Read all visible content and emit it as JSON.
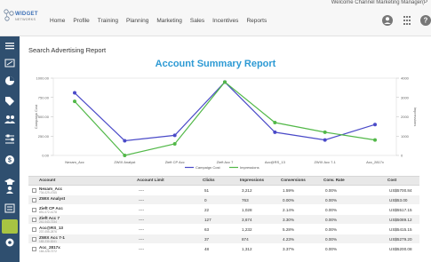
{
  "header": {
    "welcome": "Welcome Channel Marketing Manager(P",
    "logo_main": "WIDGET",
    "logo_sub": "NETWORKS",
    "nav": [
      "Home",
      "Profile",
      "Training",
      "Planning",
      "Marketing",
      "Sales",
      "Incentives",
      "Reports"
    ],
    "icons": [
      "user-icon",
      "apps-grid-icon",
      "help-icon"
    ]
  },
  "sidebar": {
    "icons": [
      "menu-icon",
      "dashboard-icon",
      "pie-chart-icon",
      "tag-icon",
      "people-icon",
      "sliders-icon",
      "dollar-icon",
      "cap-icon",
      "person-active-icon",
      "news-icon",
      "settings-icon"
    ],
    "active_color": "#a7c442",
    "bg_color": "#2f4f6f"
  },
  "page": {
    "title": "Search Advertising Report"
  },
  "chart_data": {
    "type": "line",
    "title": "Account Summary Report",
    "categories": [
      "Nexam_Acc",
      "ZWIX Analyst",
      "Zieft CP Acc",
      "Zieft Acc 7",
      "Acc@RS_13",
      "ZWIX Acc 7-1",
      "Acc_2817x"
    ],
    "ylabel_left": "Campaign Cost",
    "ylabel_right": "Impressions",
    "ylim_left": [
      0,
      1000
    ],
    "ylim_right": [
      0,
      4000
    ],
    "left_ticks": [
      "1000.00",
      "750.00",
      "500.00",
      "250.00",
      "0.00"
    ],
    "right_ticks": [
      "4000",
      "3000",
      "2000",
      "1000",
      "0"
    ],
    "series": [
      {
        "name": "Campaign Cost",
        "axis": "left",
        "color": "#4a4ac8",
        "values": [
          810,
          190,
          260,
          950,
          300,
          200,
          400
        ]
      },
      {
        "name": "Impressions",
        "axis": "right",
        "color": "#52b848",
        "values": [
          2800,
          0,
          600,
          3800,
          1700,
          1200,
          800
        ]
      }
    ],
    "legend": [
      "Campaign Cost",
      "Impressions"
    ]
  },
  "table": {
    "columns": [
      "Account",
      "Account Limit",
      "Clicks",
      "Impressions",
      "Conversions",
      "Conv. Rate",
      "Cost"
    ],
    "rows": [
      {
        "name": "Nexam_Acc",
        "sub": "734-029-4765",
        "limit": "----",
        "clicks": "51",
        "impressions": "3,212",
        "conversions": "1.59%",
        "conv_rate": "0.00%",
        "cost": "US$5700.84"
      },
      {
        "name": "ZWIX Analyst",
        "sub": "",
        "limit": "----",
        "clicks": "0",
        "impressions": "763",
        "conversions": "0.00%",
        "conv_rate": "0.00%",
        "cost": "US$53.00"
      },
      {
        "name": "Zieft CP Acc",
        "sub": "891-072-4178",
        "limit": "----",
        "clicks": "22",
        "impressions": "1,028",
        "conversions": "2.14%",
        "conv_rate": "0.00%",
        "cost": "US$5517.15"
      },
      {
        "name": "Zieft Acc 7",
        "sub": "241-043-7234",
        "limit": "----",
        "clicks": "127",
        "impressions": "3,674",
        "conversions": "3.30%",
        "conv_rate": "0.00%",
        "cost": "US$5089.12"
      },
      {
        "name": "Acc@RS_13",
        "sub": "237-055-2876",
        "limit": "----",
        "clicks": "63",
        "impressions": "1,232",
        "conversions": "5.28%",
        "conv_rate": "0.00%",
        "cost": "US$5415.15"
      },
      {
        "name": "ZWIX Acc 7-1",
        "sub": "183-230-5241",
        "limit": "----",
        "clicks": "37",
        "impressions": "874",
        "conversions": "4.23%",
        "conv_rate": "0.00%",
        "cost": "US$5279.20"
      },
      {
        "name": "Acc_2817x",
        "sub": "164-228-7272",
        "limit": "----",
        "clicks": "48",
        "impressions": "1,312",
        "conversions": "3.37%",
        "conv_rate": "0.00%",
        "cost": "US$5200.08"
      }
    ]
  }
}
